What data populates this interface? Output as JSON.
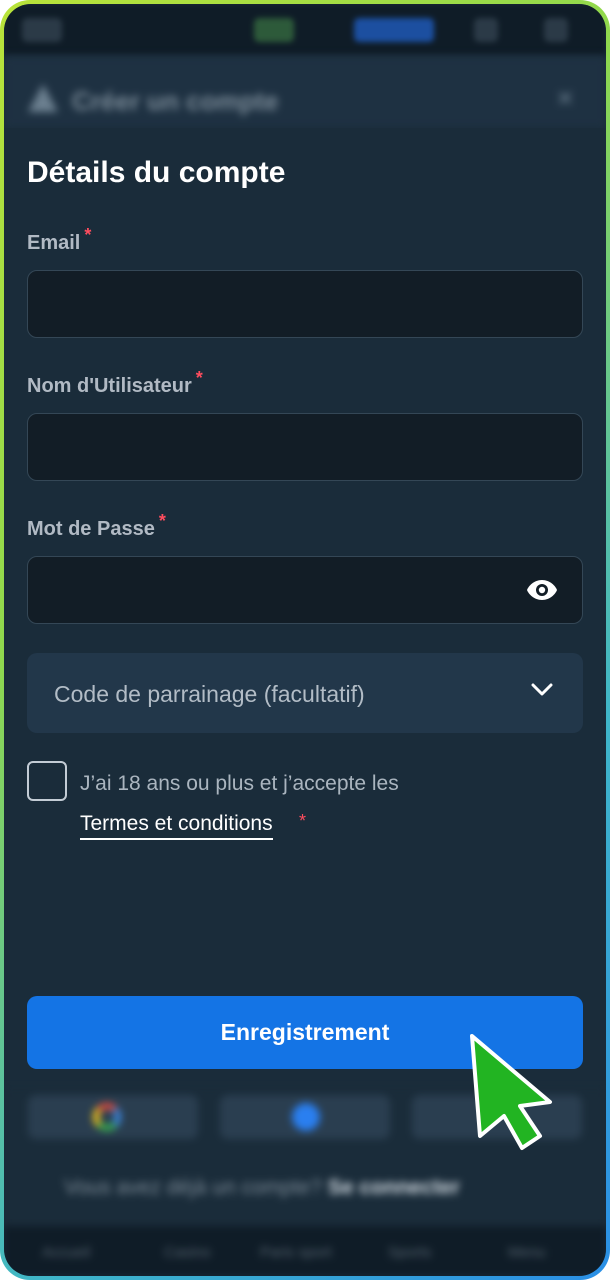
{
  "header": {
    "title": "Créer un compte"
  },
  "form": {
    "section_title": "Détails du compte",
    "required_mark": "*",
    "email": {
      "label": "Email",
      "value": ""
    },
    "username": {
      "label": "Nom d'Utilisateur",
      "value": ""
    },
    "password": {
      "label": "Mot de Passe",
      "value": ""
    },
    "referral": {
      "label": "Code de parrainage (facultatif)"
    },
    "terms": {
      "text": "J’ai 18 ans ou plus et j’accepte les",
      "link": "Termes et conditions",
      "checked": false
    },
    "submit_label": "Enregistrement"
  },
  "footer": {
    "login_prompt": "Vous avez déjà un compte?",
    "login_link": "Se connecter",
    "nav": [
      "Accueil",
      "Casino",
      "Paris sport",
      "Sports",
      "Menu"
    ]
  },
  "colors": {
    "primary_button": "#1474e5",
    "background": "#1a2c3a",
    "required": "#ff4d5e",
    "cursor": "#22b422"
  }
}
